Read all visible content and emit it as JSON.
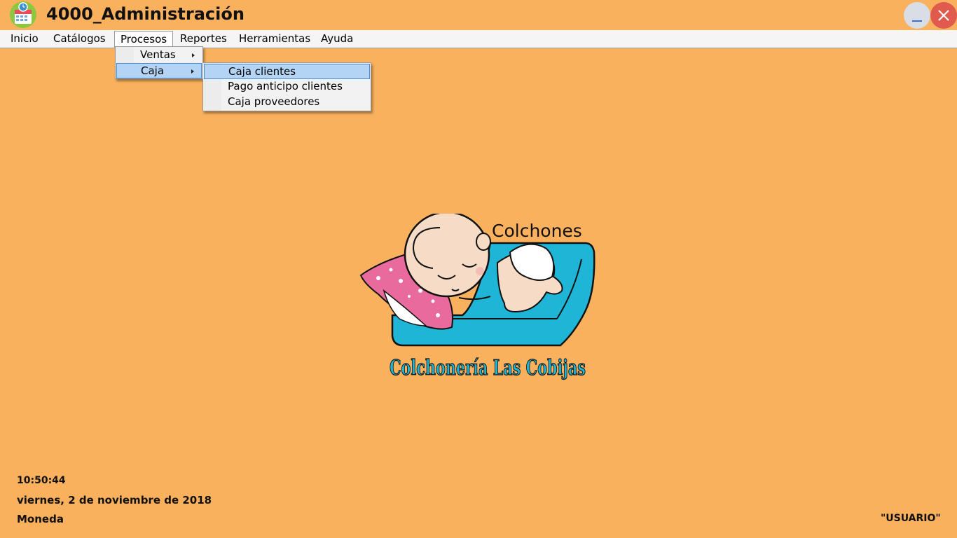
{
  "window": {
    "title": "4000_Administración"
  },
  "menubar": {
    "items": [
      "Inicio",
      "Catálogos",
      "Procesos",
      "Reportes",
      "Herramientas",
      "Ayuda"
    ]
  },
  "procesos_menu": {
    "items": [
      "Ventas",
      "Caja"
    ]
  },
  "caja_submenu": {
    "items": [
      "Caja clientes",
      "Pago anticipo clientes",
      "Caja proveedores"
    ]
  },
  "logo": {
    "top_text": "Colchones",
    "brand_text": "Colchonería Las Cobijas"
  },
  "status": {
    "time": "10:50:44",
    "date": "viernes, 2 de noviembre de 2018",
    "currency": "Moneda",
    "user": "\"USUARIO\""
  },
  "colors": {
    "background": "#fab15d",
    "highlight": "#b3d4f5",
    "logo_blue": "#1fb5d6",
    "pillow_pink": "#e96a9c"
  }
}
